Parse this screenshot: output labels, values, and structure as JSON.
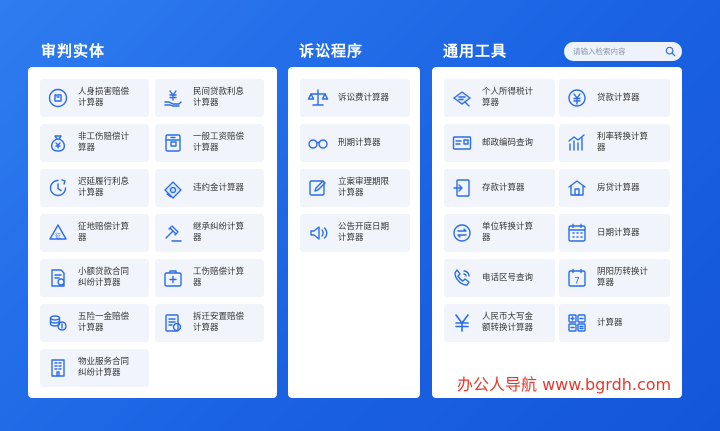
{
  "sections": {
    "trial": {
      "title": "审判实体"
    },
    "procedure": {
      "title": "诉讼程序"
    },
    "tools": {
      "title": "通用工具"
    }
  },
  "search": {
    "placeholder": "请输入检索内容"
  },
  "trial_items": [
    {
      "label": "人身损害赔偿\n计算器",
      "icon": "compensation-icon"
    },
    {
      "label": "民间贷款利息\n计算器",
      "icon": "yuan-hand-icon"
    },
    {
      "label": "非工伤赔偿计\n算器",
      "icon": "money-bag-icon"
    },
    {
      "label": "一般工资赔偿\n计算器",
      "icon": "wallet-icon"
    },
    {
      "label": "迟延履行利息\n计算器",
      "icon": "clock-icon"
    },
    {
      "label": "违约金计算器",
      "icon": "cash-icon"
    },
    {
      "label": "征地赔偿计算\n器",
      "icon": "land-icon"
    },
    {
      "label": "继承纠纷计算\n器",
      "icon": "gavel-icon"
    },
    {
      "label": "小额贷款合同\n纠纷计算器",
      "icon": "contract-icon"
    },
    {
      "label": "工伤赔偿计算\n器",
      "icon": "medkit-icon"
    },
    {
      "label": "五险一金赔偿\n计算器",
      "icon": "coins-icon"
    },
    {
      "label": "拆迁安置赔偿\n计算器",
      "icon": "document-icon"
    },
    {
      "label": "物业服务合同\n纠纷计算器",
      "icon": "building-icon"
    }
  ],
  "procedure_items": [
    {
      "label": "诉讼费计算器",
      "icon": "scale-icon"
    },
    {
      "label": "刑期计算器",
      "icon": "handcuffs-icon"
    },
    {
      "label": "立案审理期限\n计算器",
      "icon": "edit-icon"
    },
    {
      "label": "公告开庭日期\n计算器",
      "icon": "speaker-icon"
    }
  ],
  "tool_items": [
    {
      "label": "个人所得税计\n算器",
      "icon": "tax-icon"
    },
    {
      "label": "贷款计算器",
      "icon": "yuan-circle-icon"
    },
    {
      "label": "邮政编码查询",
      "icon": "postcard-icon"
    },
    {
      "label": "利率转换计算\n器",
      "icon": "bar-chart-icon"
    },
    {
      "label": "存款计算器",
      "icon": "deposit-icon"
    },
    {
      "label": "房贷计算器",
      "icon": "house-icon"
    },
    {
      "label": "单位转换计算\n器",
      "icon": "exchange-icon"
    },
    {
      "label": "日期计算器",
      "icon": "calendar-icon"
    },
    {
      "label": "电话区号查询",
      "icon": "phone-icon"
    },
    {
      "label": "阴阳历转换计\n算器",
      "icon": "calendar7-icon"
    },
    {
      "label": "人民币大写金\n额转换计算器",
      "icon": "yuan-icon"
    },
    {
      "label": "计算器",
      "icon": "calculator-icon"
    }
  ],
  "watermark": "办公人导航 www.bgrdh.com",
  "colors": {
    "accent": "#2b6de8",
    "background": "#1a63e3",
    "card": "#f1f5fb",
    "watermark": "#e23a2e"
  }
}
